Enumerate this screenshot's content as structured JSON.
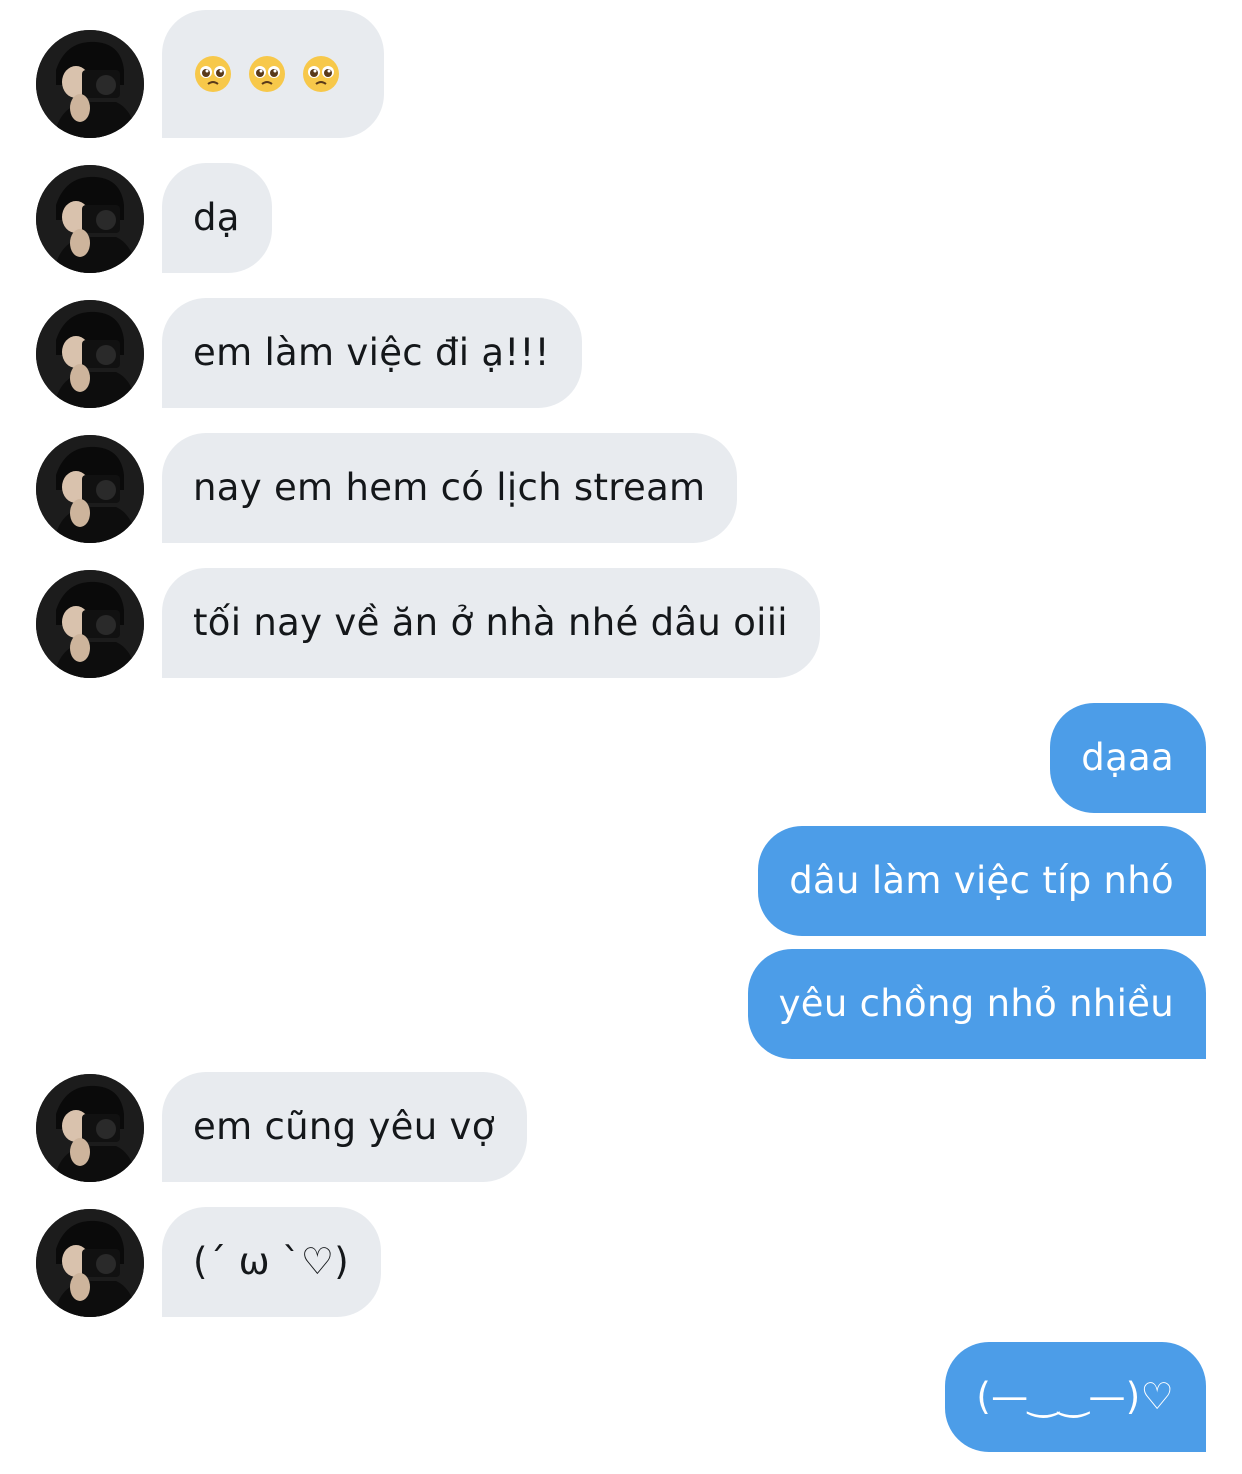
{
  "messages": [
    {
      "side": "in",
      "text": "",
      "emoji": [
        "pleading-face",
        "pleading-face",
        "pleading-face"
      ]
    },
    {
      "side": "in",
      "text": "dạ"
    },
    {
      "side": "in",
      "text": "em làm việc đi ạ!!!"
    },
    {
      "side": "in",
      "text": "nay em hem có lịch stream"
    },
    {
      "side": "in",
      "text": "tối nay về ăn ở nhà nhé dâu oiii"
    },
    {
      "side": "out",
      "text": "dạaa"
    },
    {
      "side": "out",
      "text": "dâu làm việc típ nhó"
    },
    {
      "side": "out",
      "text": "yêu chồng nhỏ nhiều"
    },
    {
      "side": "in",
      "text": "em cũng yêu vợ"
    },
    {
      "side": "in",
      "text": "(´ ω `♡)"
    },
    {
      "side": "out",
      "text": "(—‿‿—)♡"
    }
  ],
  "colors": {
    "incoming_bubble": "#e8ebef",
    "outgoing_bubble": "#4c9de8",
    "incoming_text": "#14171a",
    "outgoing_text": "#ffffff"
  }
}
